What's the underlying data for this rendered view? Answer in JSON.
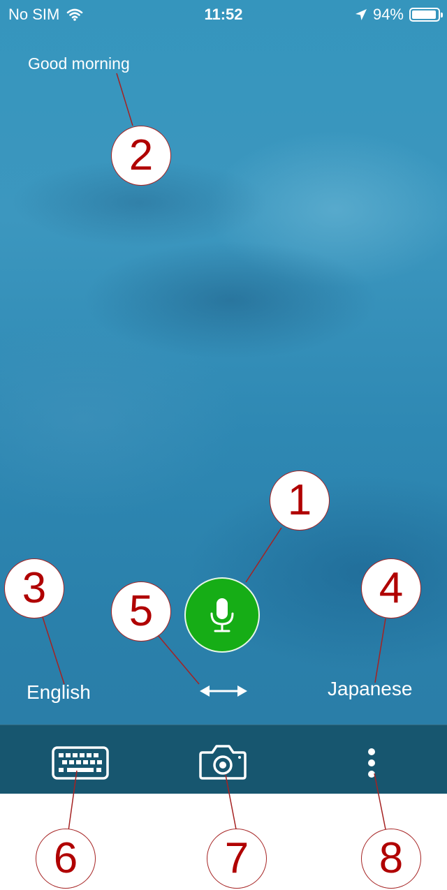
{
  "status_bar": {
    "carrier": "No SIM",
    "time": "11:52",
    "battery_percent": "94%",
    "battery_level": 0.94
  },
  "main": {
    "greeting": "Good morning",
    "source_language": "English",
    "target_language": "Japanese"
  },
  "icons": {
    "wifi": "wifi-icon",
    "location": "location-arrow-icon",
    "battery": "battery-icon",
    "microphone": "microphone-icon",
    "swap": "swap-arrows-icon",
    "keyboard": "keyboard-icon",
    "camera": "camera-icon",
    "more": "more-vertical-icon"
  },
  "callouts": [
    "1",
    "2",
    "3",
    "4",
    "5",
    "6",
    "7",
    "8"
  ],
  "colors": {
    "background": "#3595bd",
    "toolbar": "#17566f",
    "mic_button": "#16ad16",
    "callout": "#b00000"
  }
}
